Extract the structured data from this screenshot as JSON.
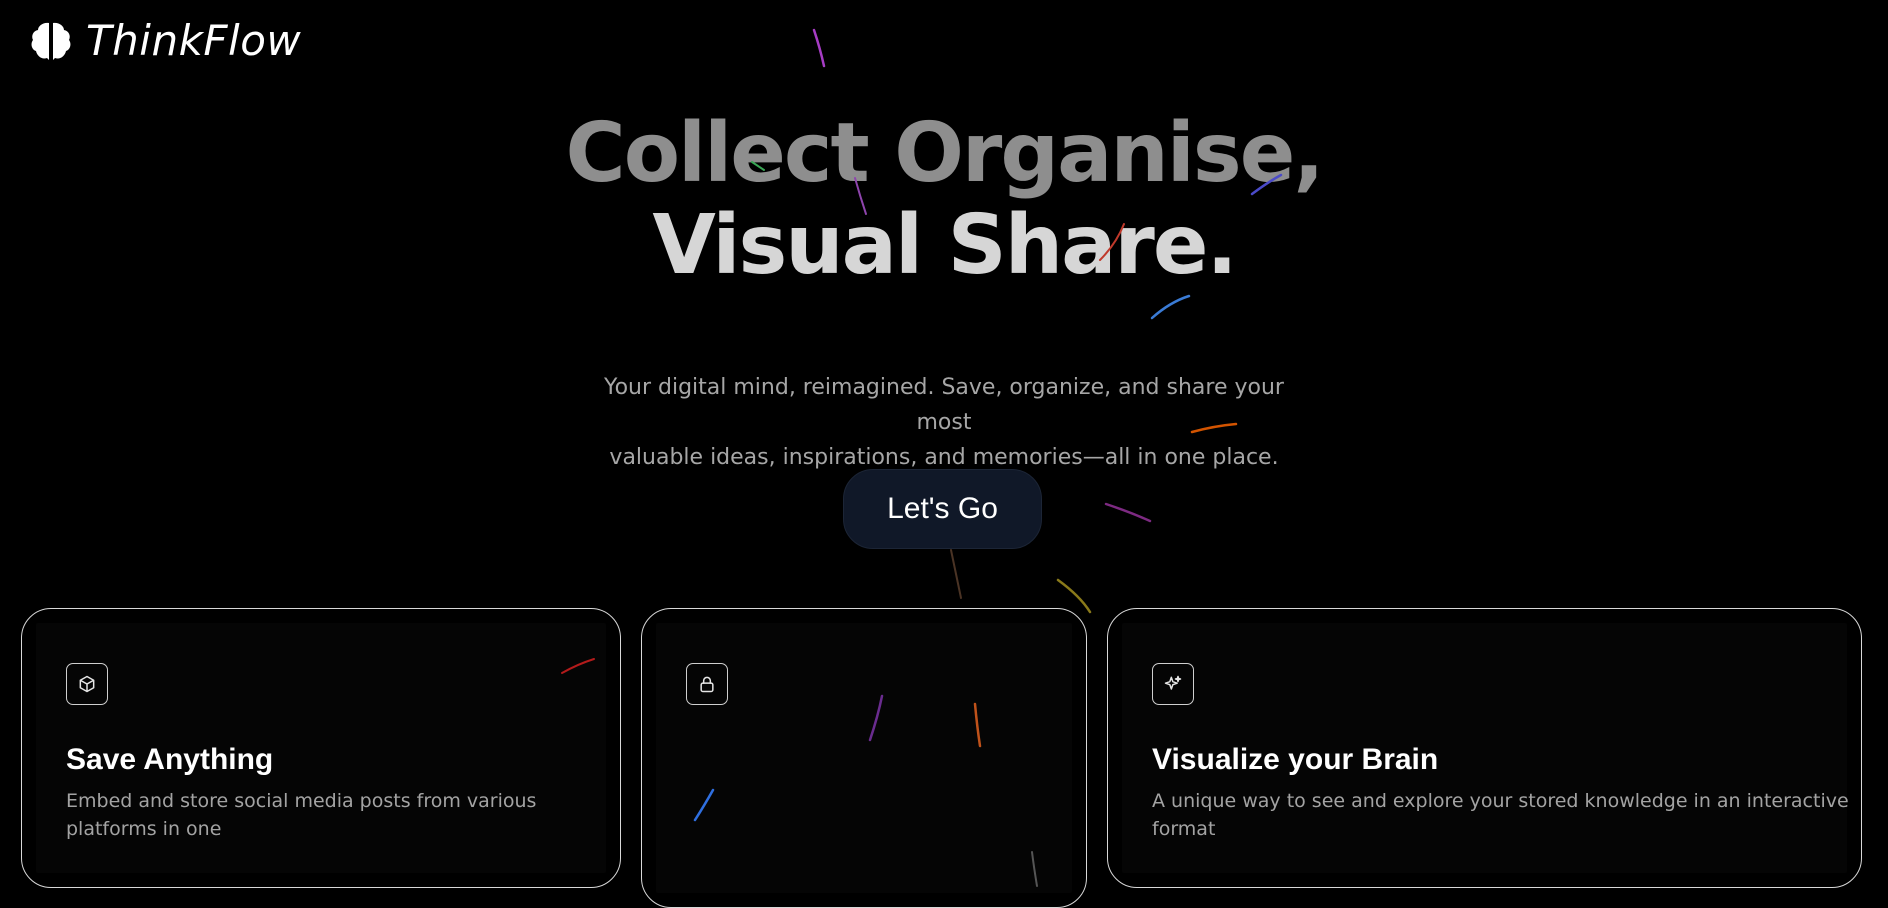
{
  "brand": {
    "name": "ThinkFlow",
    "logo_icon": "brain-icon"
  },
  "hero": {
    "line1": "Collect Organise,",
    "line2": "Visual Share.",
    "subtitle_line1": "Your digital mind, reimagined. Save, organize, and share your most",
    "subtitle_line2": "valuable ideas, inspirations, and memories—all in one place.",
    "cta_label": "Let's Go"
  },
  "features": [
    {
      "icon": "cube-icon",
      "title": "Save Anything",
      "desc_line1": "Embed and store social media posts from various",
      "desc_line2": "platforms in one"
    },
    {
      "icon": "lock-icon",
      "title": "",
      "desc_line1": "",
      "desc_line2": ""
    },
    {
      "icon": "sparkles-icon",
      "title": "Visualize your Brain",
      "desc_line1": "A unique way to see and explore your stored knowledge in an interactive",
      "desc_line2": "format"
    }
  ],
  "colors": {
    "background": "#000000",
    "cta_background": "#101828",
    "card_border": "#d8d8d8",
    "hero_line1": "#8e8e8e",
    "hero_line2": "#d6d6d6",
    "subtitle": "#a6a6a6"
  }
}
